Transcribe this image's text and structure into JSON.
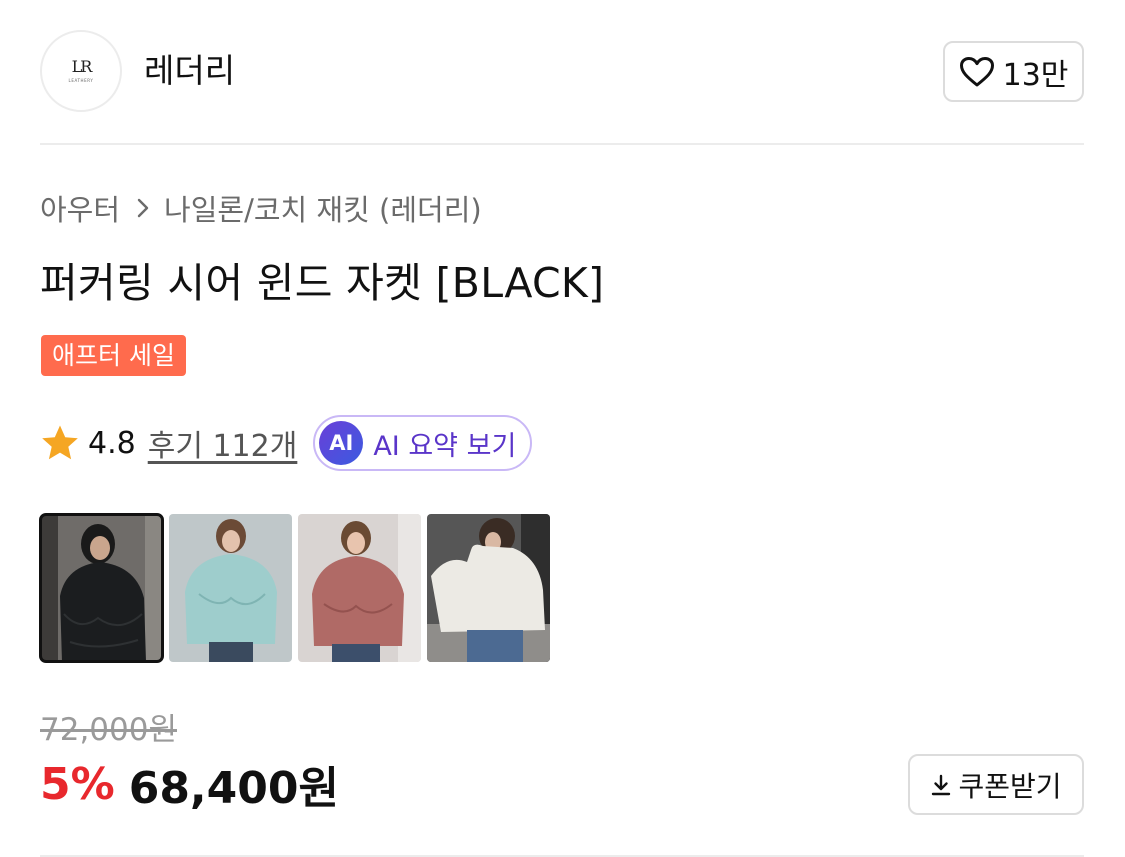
{
  "brand": {
    "name": "레더리",
    "logo_monogram": "LR",
    "logo_wordmark": "LEATHERY",
    "like_count": "13만"
  },
  "breadcrumb": {
    "category": "아우터",
    "subcategory": "나일론/코치 재킷 (레더리)"
  },
  "product": {
    "title": "퍼커링 시어 윈드 자켓 [BLACK]",
    "badge": "애프터 세일"
  },
  "rating": {
    "score": "4.8",
    "reviews_label": "후기 112개",
    "ai_chip": "AI",
    "ai_summary_label": "AI 요약 보기",
    "star_color": "#f5a623"
  },
  "thumbnails": [
    {
      "color_name": "black",
      "jacket_color": "#1b1d1f",
      "background": "#6f6c69",
      "selected": true
    },
    {
      "color_name": "mint",
      "jacket_color": "#9ecdcc",
      "background": "#bfc7c9",
      "selected": false
    },
    {
      "color_name": "pink",
      "jacket_color": "#b06a66",
      "background": "#d9d4d2",
      "selected": false
    },
    {
      "color_name": "white",
      "jacket_color": "#eceae4",
      "background": "#565656",
      "selected": false
    }
  ],
  "price": {
    "original": "72,000원",
    "discount_rate": "5%",
    "sale": "68,400원",
    "coupon_label": "쿠폰받기",
    "discount_color": "#e8282d"
  },
  "colors": {
    "badge": "#ff6b4d",
    "ai_accent": "#5a35c9"
  }
}
